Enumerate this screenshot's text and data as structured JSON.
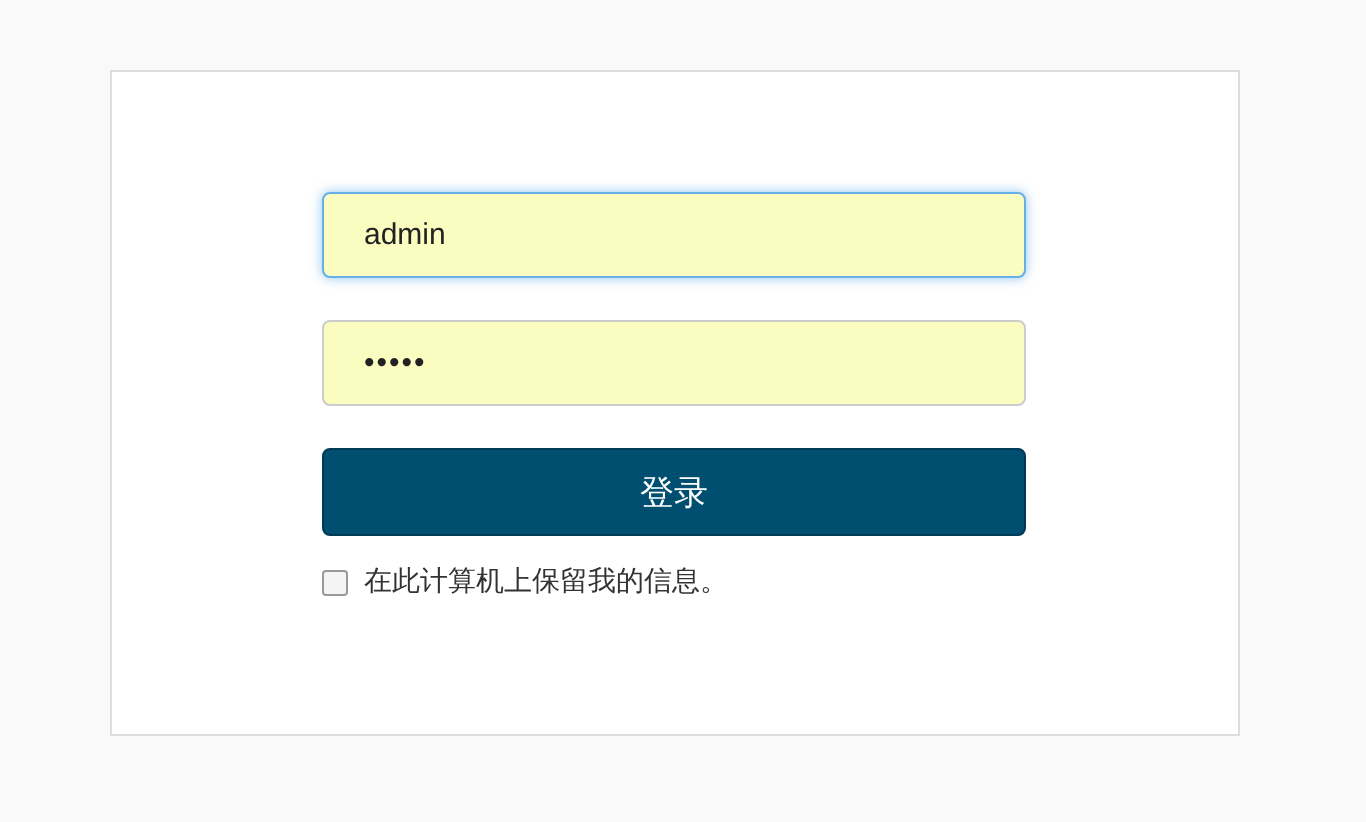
{
  "login_form": {
    "fields": [
      {
        "kind": "text",
        "value": "admin",
        "focused": true
      },
      {
        "kind": "password",
        "value": "•••••",
        "focused": false
      }
    ],
    "submit_button": {
      "label": "登录"
    },
    "remember": {
      "label": "在此计算机上保留我的信息。",
      "checked": false
    }
  }
}
